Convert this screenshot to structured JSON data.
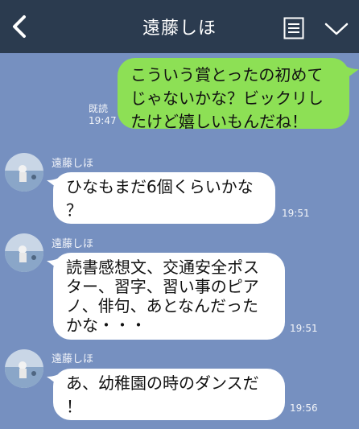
{
  "header": {
    "title": "遠藤しほ",
    "back_icon": "chevron-left-icon",
    "menu_icon": "note-icon",
    "collapse_icon": "chevron-down-icon"
  },
  "colors": {
    "background": "#7690c0",
    "header": "#2b3b4f",
    "sent_bubble": "#8de055",
    "received_bubble": "#ffffff"
  },
  "messages": [
    {
      "direction": "sent",
      "text": "こういう賞とったの初めて\nじゃないかな？ビックリし\nたけど嬉しいもんだね！",
      "read_label": "既読",
      "time": "19:47"
    },
    {
      "direction": "received",
      "sender": "遠藤しほ",
      "text": "ひなもまだ6個くらいかな\n？",
      "time": "19:51"
    },
    {
      "direction": "received",
      "sender": "遠藤しほ",
      "text": "読書感想文、交通安全ポス\nター、習字、習い事のピア\nノ、俳句、あとなんだった\nかな・・・",
      "time": "19:51"
    },
    {
      "direction": "received",
      "sender": "遠藤しほ",
      "text": "あ、幼稚園の時のダンスだ\n！",
      "time": "19:56"
    }
  ]
}
